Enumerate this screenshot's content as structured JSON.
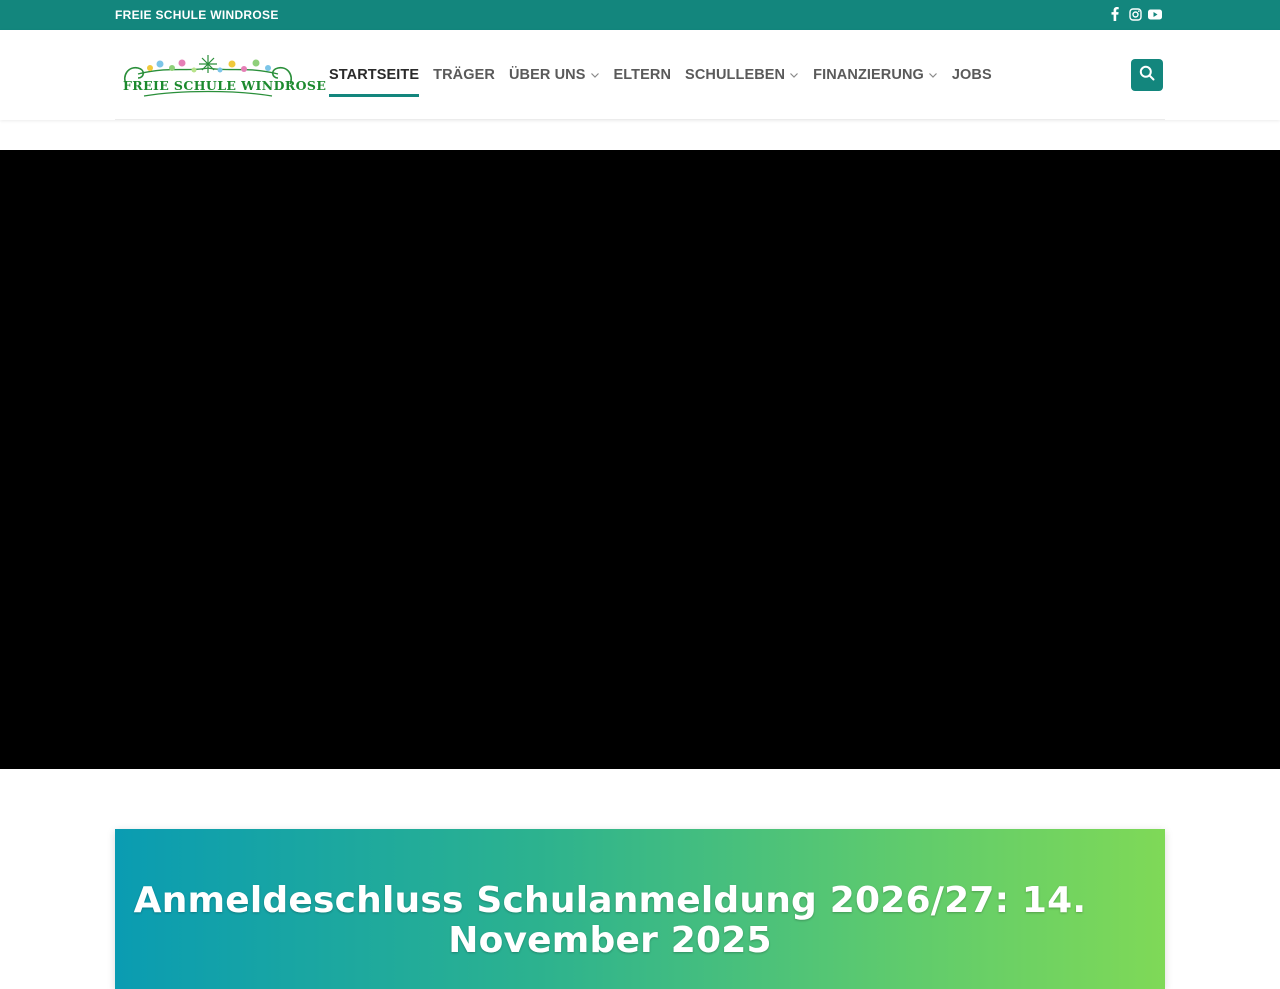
{
  "topbar": {
    "brand": "FREIE SCHULE WINDROSE",
    "social": [
      "facebook-icon",
      "instagram-icon",
      "youtube-icon"
    ]
  },
  "header": {
    "logo_text": "FREIE SCHULE WINDROSE",
    "nav": [
      {
        "label": "STARTSEITE",
        "active": true,
        "dropdown": false
      },
      {
        "label": "TRÄGER",
        "active": false,
        "dropdown": false
      },
      {
        "label": "ÜBER UNS",
        "active": false,
        "dropdown": true
      },
      {
        "label": "ELTERN",
        "active": false,
        "dropdown": false
      },
      {
        "label": "SCHULLEBEN",
        "active": false,
        "dropdown": true
      },
      {
        "label": "FINANZIERUNG",
        "active": false,
        "dropdown": true
      },
      {
        "label": "JOBS",
        "active": false,
        "dropdown": false
      }
    ],
    "search_icon": "search-icon"
  },
  "banner": {
    "headline": "Anmeldeschluss Schulanmeldung 2026/27: 14. November 2025"
  },
  "colors": {
    "primary": "#13867d",
    "gradient_start": "#0a9cb2",
    "gradient_end": "#7fd957",
    "video_bg": "#000000"
  }
}
